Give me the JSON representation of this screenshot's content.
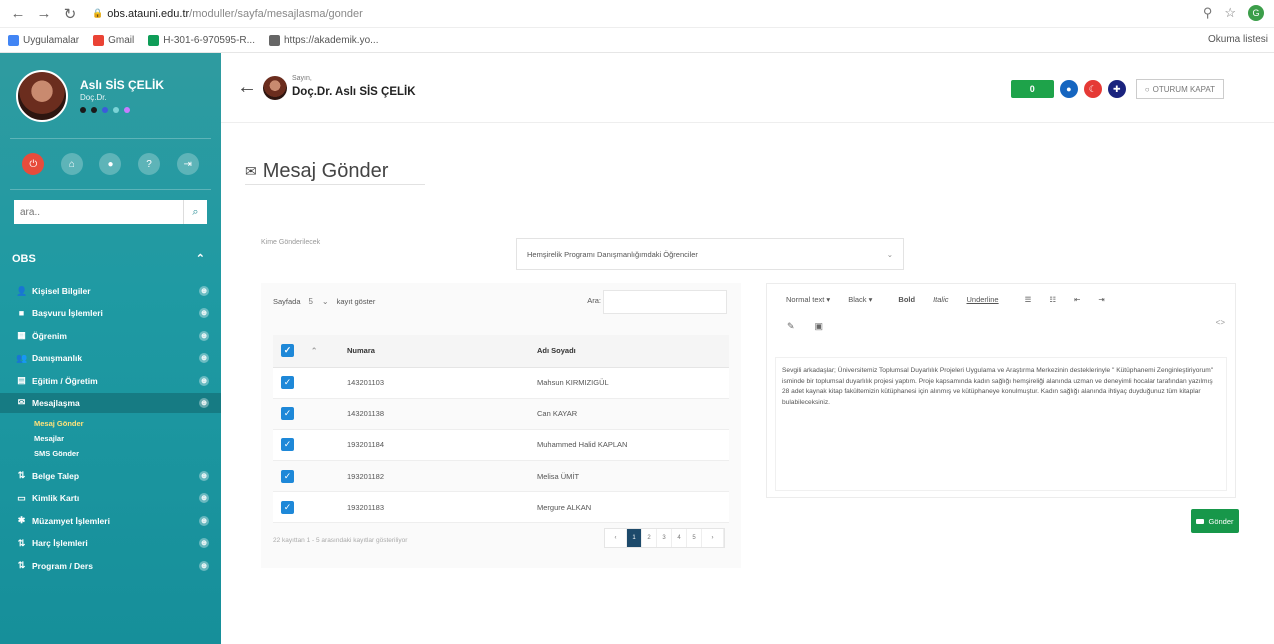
{
  "browser": {
    "url_host": "obs.atauni.edu.tr",
    "url_path": "/moduller/sayfa/mesajlasma/gonder",
    "profile_initial": "G",
    "bookmarks": [
      {
        "label": "Uygulamalar",
        "color": "#4285f4"
      },
      {
        "label": "Gmail",
        "color": "#ea4335"
      },
      {
        "label": "H-301-6-970595-R...",
        "color": "#0f9d58"
      },
      {
        "label": "https://akademik.yo...",
        "color": "#666666"
      }
    ],
    "reading_list": "Okuma listesi"
  },
  "sidebar": {
    "user_name": "Aslı SİS ÇELİK",
    "user_title": "Doç.Dr.",
    "search_placeholder": "ara..",
    "section_title": "OBS",
    "items": [
      {
        "label": "Kişisel Bilgiler",
        "icon": "👤",
        "name": "kisisel-bilgiler"
      },
      {
        "label": "Başvuru İşlemleri",
        "icon": "■",
        "name": "basvuru-islemleri"
      },
      {
        "label": "Öğrenim",
        "icon": "▦",
        "name": "ogrenim"
      },
      {
        "label": "Danışmanlık",
        "icon": "👥",
        "name": "danismanlik"
      },
      {
        "label": "Eğitim / Öğretim",
        "icon": "▤",
        "name": "egitim-ogretim"
      },
      {
        "label": "Mesajlaşma",
        "icon": "✉",
        "name": "mesajlasma"
      }
    ],
    "submenu": [
      "Mesaj Gönder",
      "Mesajlar",
      "SMS Gönder"
    ],
    "items_after": [
      {
        "label": "Belge Talep",
        "icon": "⇅",
        "name": "belge-talep"
      },
      {
        "label": "Kimlik Kartı",
        "icon": "▭",
        "name": "kimlik-karti"
      },
      {
        "label": "Müzamyet İşlemleri",
        "icon": "✱",
        "name": "muzamyet-islemleri"
      },
      {
        "label": "Harç İşlemleri",
        "icon": "⇅",
        "name": "harc-islemleri"
      },
      {
        "label": "Program / Ders",
        "icon": "⇅",
        "name": "program-ders"
      }
    ]
  },
  "topbar": {
    "greeting": "Sayın,",
    "user": "Doç.Dr. Aslı SİS ÇELİK",
    "counter": "0",
    "logout": "OTURUM KAPAT"
  },
  "page": {
    "title": "Mesaj Gönder",
    "recipient_label": "Kime Gönderilecek",
    "recipient_value": "Hemşirelik Programı Danışmanlığımdaki Öğrenciler"
  },
  "table": {
    "show_prefix": "Sayfada",
    "page_length": "5",
    "show_suffix": "kayıt göster",
    "search_label": "Ara:",
    "col_numara": "Numara",
    "col_ad": "Adı Soyadı",
    "rows": [
      {
        "numara": "143201103",
        "ad": "Mahsun KIRMIZIGÜL"
      },
      {
        "numara": "143201138",
        "ad": "Can KAYAR"
      },
      {
        "numara": "193201184",
        "ad": "Muhammed Halid KAPLAN"
      },
      {
        "numara": "193201182",
        "ad": "Melisa ÜMİT"
      },
      {
        "numara": "193201183",
        "ad": "Mergure ALKAN"
      }
    ],
    "footer": "22 kayıttan 1 - 5 arasındaki kayıtlar gösteriliyor",
    "pages": [
      "‹",
      "1",
      "2",
      "3",
      "4",
      "5",
      "›"
    ]
  },
  "editor": {
    "style_btn": "Normal text ▾",
    "color_btn": "Black ▾",
    "bold": "Bold",
    "italic": "Italic",
    "underline": "Underline",
    "body": "Sevgili arkadaşlar; Üniversitemiz Toplumsal Duyarlılık Projeleri Uygulama ve Araştırma Merkezinin desteklerinyle \" Kütüphanemi Zenginleştiriyorum\" isminde bir toplumsal duyarlılık projesi yaptım. Proje kapsamında kadın sağlığı hemşireliği alanında uzman ve deneyimli hocalar tarafından yazılmış 28 adet kaynak kitap fakültemizin kütüphanesi için alınmış ve kütüphaneye konulmuştur. Kadın sağlığı alanında ihtiyaç duyduğunuz tüm kitaplar bulabileceksiniz."
  },
  "send_label": "Gönder",
  "colors": {
    "sidebar": "#1f9aa3",
    "send": "#17974a",
    "checkbox": "#1e88d8",
    "pager_active": "#1d4a6b"
  }
}
